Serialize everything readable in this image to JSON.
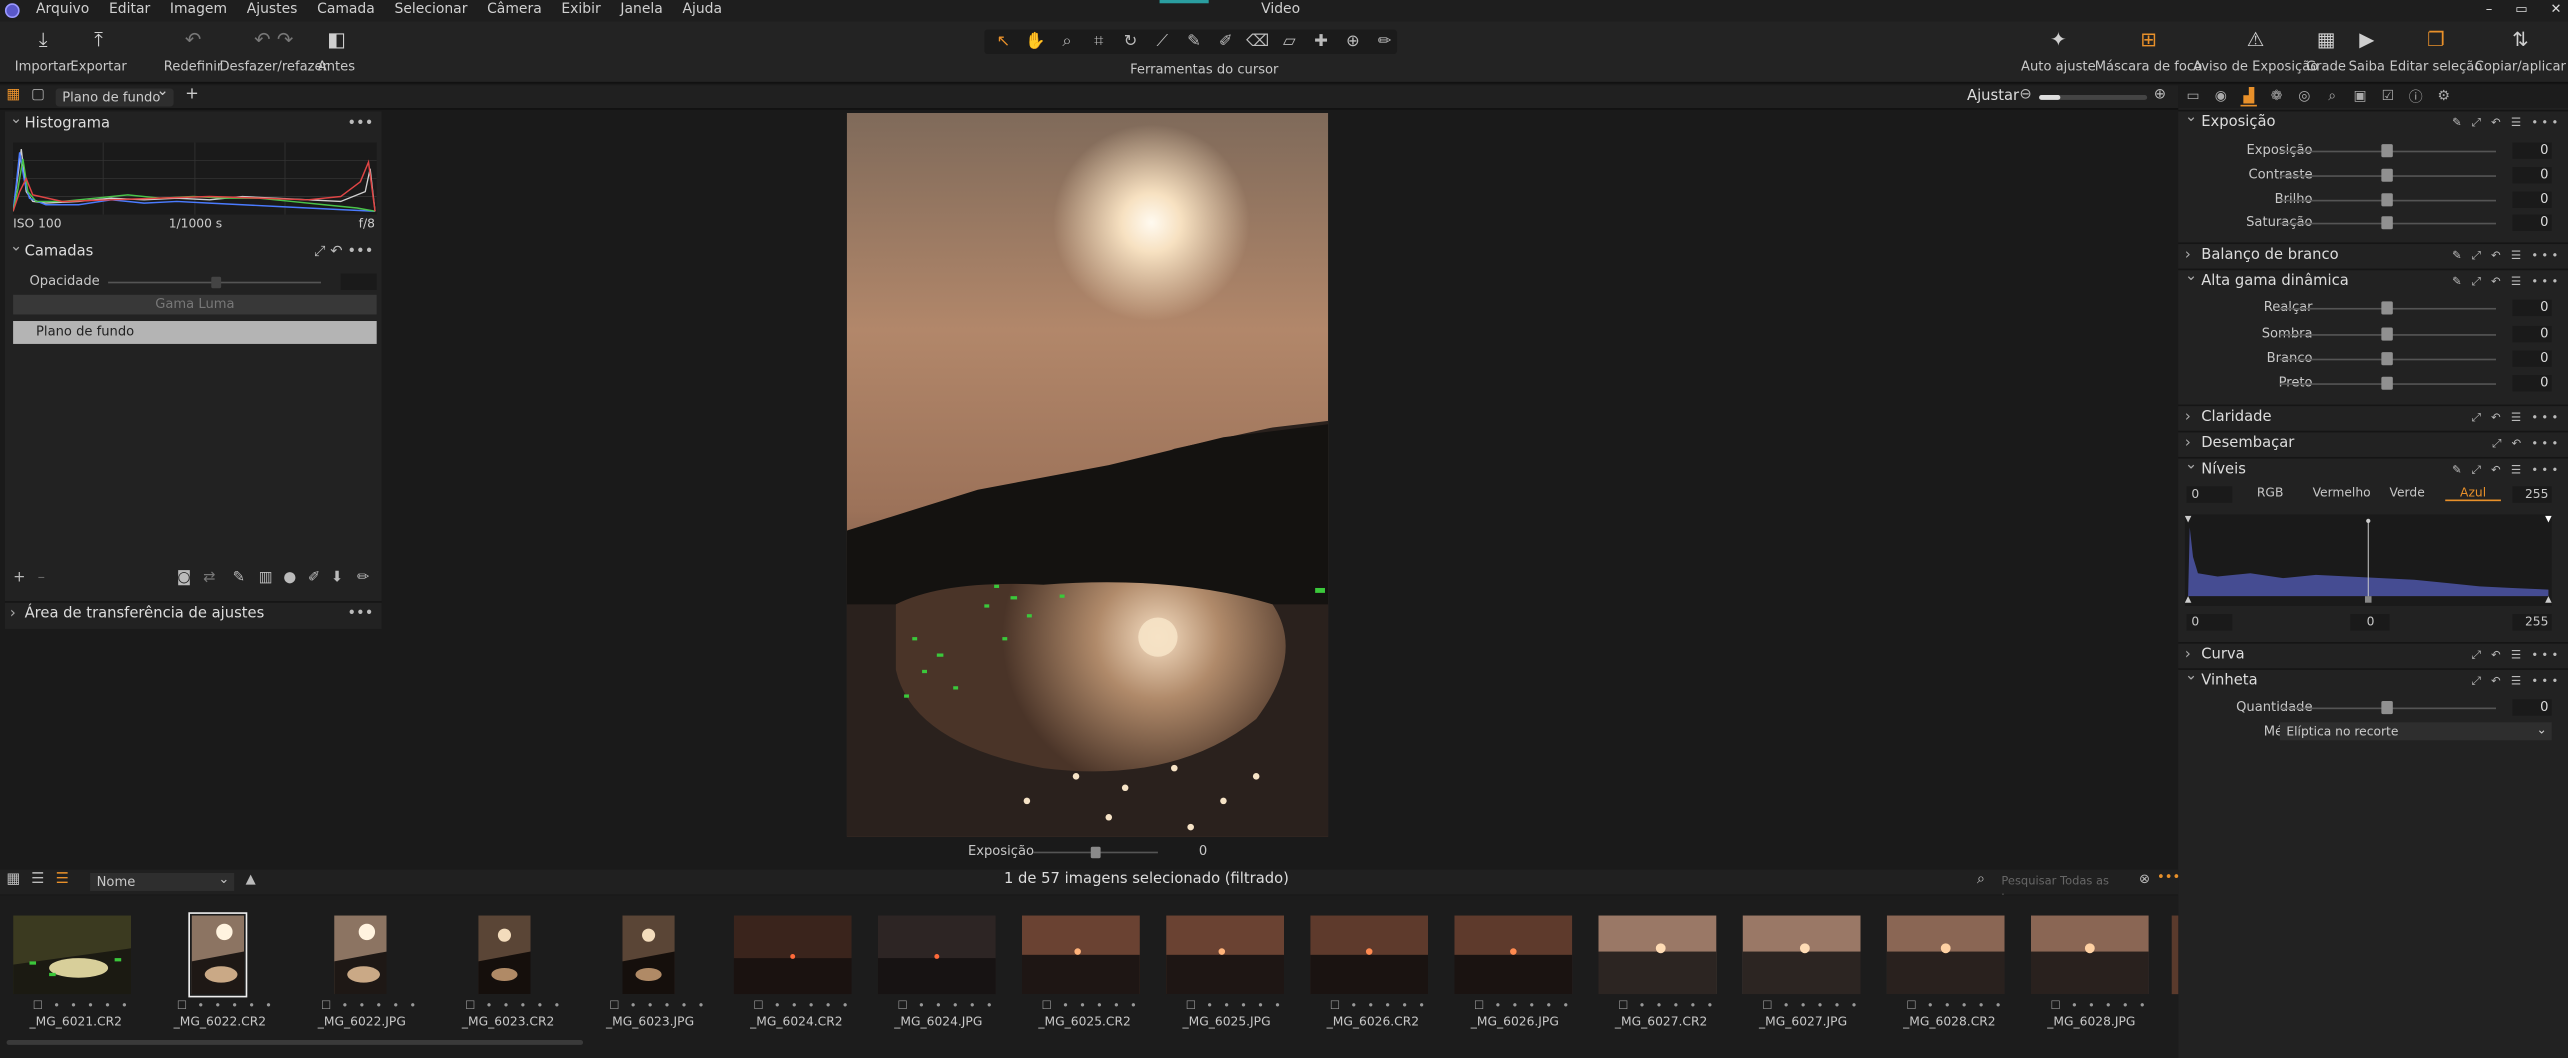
{
  "app": {
    "title": "Video"
  },
  "menu": [
    "Arquivo",
    "Editar",
    "Imagem",
    "Ajustes",
    "Camada",
    "Selecionar",
    "Câmera",
    "Exibir",
    "Janela",
    "Ajuda"
  ],
  "toolbar": {
    "left": [
      {
        "label": "Importar",
        "icon": "import-icon"
      },
      {
        "label": "Exportar",
        "icon": "export-icon"
      },
      {
        "label": "Redefinir",
        "icon": "reset-icon"
      },
      {
        "label": "Desfazer/refazer",
        "icon": "undo-redo-icon"
      },
      {
        "label": "Antes",
        "icon": "before-icon"
      }
    ],
    "cursor_tools_label": "Ferramentas do cursor",
    "right": [
      {
        "label": "Auto ajuste",
        "icon": "magic-wand-icon"
      },
      {
        "label": "Máscara de foco",
        "icon": "focus-mask-icon"
      },
      {
        "label": "Aviso de Exposição",
        "icon": "warning-icon"
      },
      {
        "label": "Grade",
        "icon": "grid-icon"
      },
      {
        "label": "Saiba",
        "icon": "learn-icon"
      },
      {
        "label": "Editar seleção",
        "icon": "edit-selection-icon"
      },
      {
        "label": "Copiar/aplicar",
        "icon": "copy-apply-icon"
      }
    ]
  },
  "subbar": {
    "view": "Plano de fundo",
    "adjust_label": "Ajustar"
  },
  "left": {
    "histogram": {
      "title": "Histograma",
      "iso": "ISO 100",
      "shutter": "1/1000 s",
      "aperture": "f/8"
    },
    "layers": {
      "title": "Camadas",
      "opacity_label": "Opacidade",
      "luma": "Gama Luma",
      "layer": "Plano de fundo"
    },
    "transfer": {
      "title": "Área de transferência de ajustes"
    }
  },
  "viewer": {
    "exposure_label": "Exposição",
    "exposure_value": "0"
  },
  "right": {
    "exposure": {
      "title": "Exposição",
      "items": [
        {
          "label": "Exposição",
          "value": "0"
        },
        {
          "label": "Contraste",
          "value": "0"
        },
        {
          "label": "Brilho",
          "value": "0"
        },
        {
          "label": "Saturação",
          "value": "0"
        }
      ]
    },
    "white_balance": {
      "title": "Balanço de branco"
    },
    "hdr": {
      "title": "Alta gama dinâmica",
      "items": [
        {
          "label": "Realçar",
          "value": "0"
        },
        {
          "label": "Sombra",
          "value": "0"
        },
        {
          "label": "Branco",
          "value": "0"
        },
        {
          "label": "Preto",
          "value": "0"
        }
      ]
    },
    "clarity": {
      "title": "Claridade"
    },
    "dehaze": {
      "title": "Desembaçar"
    },
    "levels": {
      "title": "Níveis",
      "in_low": "0",
      "in_high": "255",
      "tabs": [
        "RGB",
        "Vermelho",
        "Verde",
        "Azul"
      ],
      "active_tab": "Azul",
      "out_low": "0",
      "mid": "0",
      "out_high": "255"
    },
    "curve": {
      "title": "Curva"
    },
    "vignette": {
      "title": "Vinheta",
      "amount_label": "Quantidade",
      "amount_value": "0",
      "method_label": "Método",
      "method_value": "Elíptica no recorte"
    }
  },
  "filmbar": {
    "sort": "Nome",
    "status": "1 de 57 imagens selecionado (filtrado)",
    "search_placeholder": "Pesquisar Todas as imagens"
  },
  "thumbs": [
    "_MG_6021.CR2",
    "_MG_6022.CR2",
    "_MG_6022.JPG",
    "_MG_6023.CR2",
    "_MG_6023.JPG",
    "_MG_6024.CR2",
    "_MG_6024.JPG",
    "_MG_6025.CR2",
    "_MG_6025.JPG",
    "_MG_6026.CR2",
    "_MG_6026.JPG",
    "_MG_6027.CR2",
    "_MG_6027.JPG",
    "_MG_6028.CR2",
    "_MG_6028.JPG"
  ],
  "colors": {
    "accent": "#e8902a",
    "selection": "#e0e0e0"
  }
}
